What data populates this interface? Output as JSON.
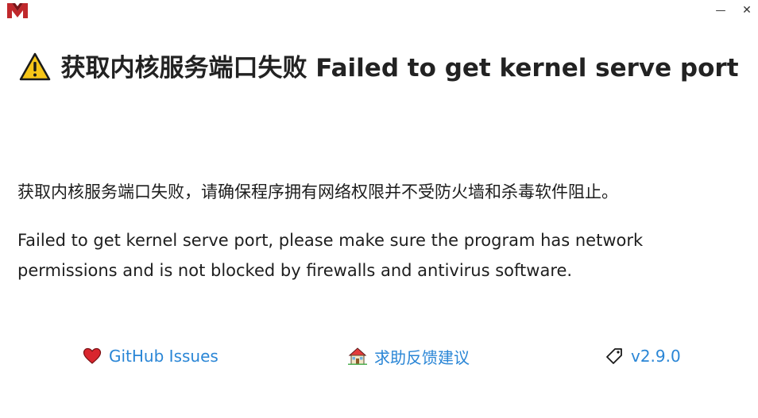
{
  "window": {
    "minimize_glyph": "—",
    "close_glyph": "✕"
  },
  "header": {
    "icon": "warning-triangle-icon",
    "title": "获取内核服务端口失败 Failed to get kernel serve port"
  },
  "messages": {
    "chinese": "获取内核服务端口失败，请确保程序拥有网络权限并不受防火墙和杀毒软件阻止。",
    "english": "Failed to get kernel serve port, please make sure the program has network permissions and is not blocked by firewalls and antivirus software."
  },
  "footer": {
    "github": {
      "icon": "heart-icon",
      "label": "GitHub Issues"
    },
    "feedback": {
      "icon": "house-icon",
      "label": "求助反馈建议"
    },
    "version": {
      "icon": "tag-icon",
      "label": "v2.9.0"
    }
  },
  "colors": {
    "link": "#2a86d6",
    "warning_yellow": "#f5c518",
    "heart_red": "#d9262e",
    "logo_red": "#c0282c"
  }
}
